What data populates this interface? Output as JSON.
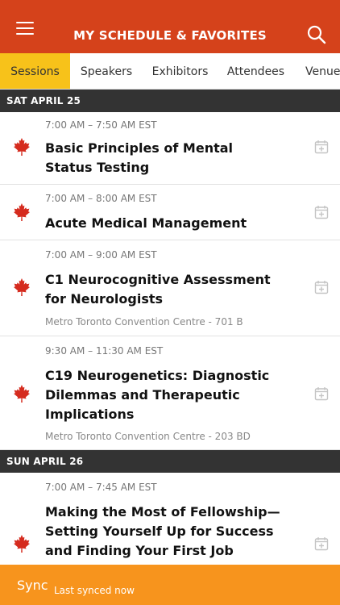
{
  "header": {
    "title": "MY SCHEDULE & FAVORITES"
  },
  "tabs": [
    {
      "label": "Sessions",
      "active": true
    },
    {
      "label": "Speakers",
      "active": false
    },
    {
      "label": "Exhibitors",
      "active": false
    },
    {
      "label": "Attendees",
      "active": false
    },
    {
      "label": "Venues",
      "active": false
    }
  ],
  "days": [
    {
      "label": "SAT APRIL 25"
    },
    {
      "label": "SUN APRIL 26"
    }
  ],
  "sessions": [
    {
      "time": "7:00 AM – 7:50 AM EST",
      "title": "Basic Principles of Mental Status Testing",
      "venue": ""
    },
    {
      "time": "7:00 AM – 8:00 AM EST",
      "title": "Acute Medical Management",
      "venue": ""
    },
    {
      "time": "7:00 AM – 9:00 AM EST",
      "title": "C1 Neurocognitive Assessment for Neurologists",
      "venue": "Metro Toronto Convention Centre - 701 B"
    },
    {
      "time": "9:30 AM – 11:30 AM EST",
      "title": "C19 Neurogenetics: Diagnostic Dilemmas and Therapeutic Implications",
      "venue": "Metro Toronto Convention Centre - 203 BD"
    },
    {
      "time": "7:00 AM – 7:45 AM EST",
      "title": "Making the Most of Fellowship—Setting Yourself Up for Success and Finding Your First Job",
      "venue": ""
    }
  ],
  "footer": {
    "sync_label": "Sync",
    "sync_status": "Last synced now"
  },
  "colors": {
    "header": "#d5421b",
    "active_tab": "#f7c21a",
    "day_header": "#333333",
    "footer": "#f7941d",
    "flag": "#d52b1e"
  }
}
